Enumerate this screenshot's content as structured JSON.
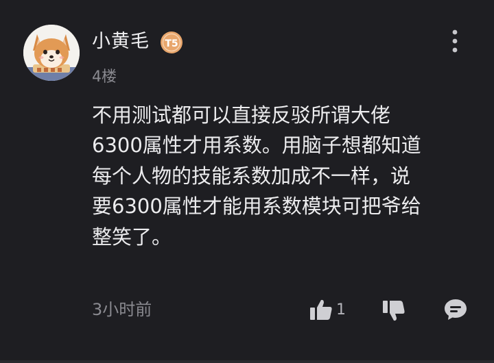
{
  "comment": {
    "username": "小黄毛",
    "badge_text": "T5",
    "floor": "4楼",
    "body_lines": [
      "不用测试都可以直接反驳所谓大佬",
      "6300属性才用系数。用脑子想都知道",
      "每个人物的技能系数加成不一样，说",
      "要6300属性才能用系数模块可把爷给",
      "整笑了。"
    ],
    "time": "3小时前",
    "like_count": "1"
  },
  "icons": {
    "more": "more-vertical-icon",
    "like": "thumbs-up-icon",
    "dislike": "thumbs-down-icon",
    "reply": "comment-bubble-icon"
  },
  "colors": {
    "background": "#1e1e22",
    "text_primary": "#ececee",
    "text_secondary": "#8a8a90",
    "badge": "#e8a66c"
  }
}
